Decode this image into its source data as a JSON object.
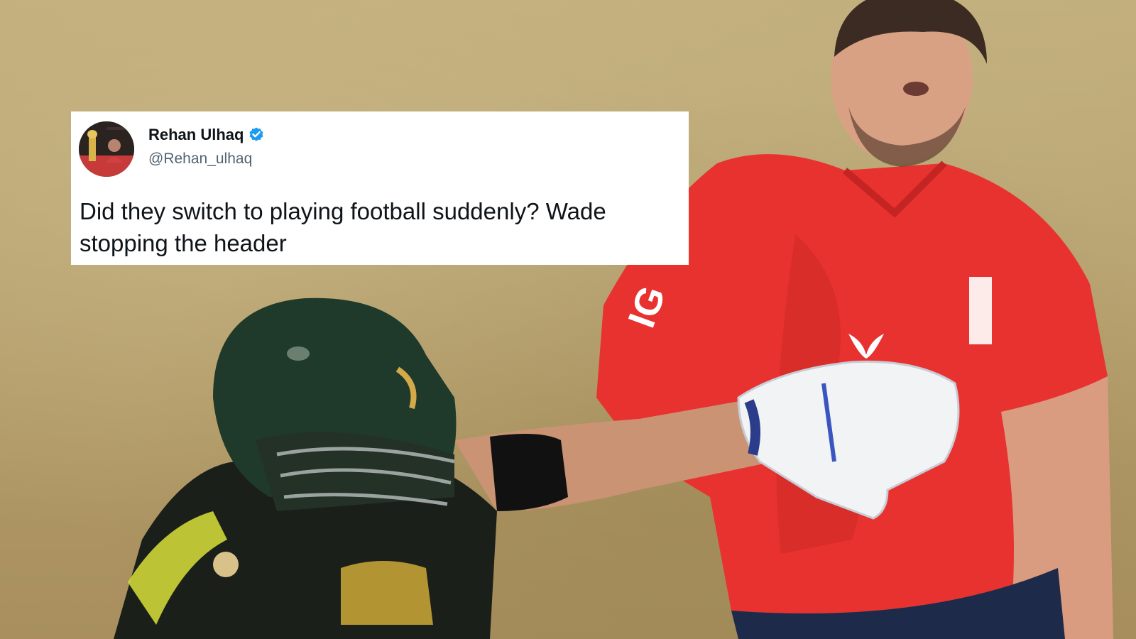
{
  "tweet": {
    "display_name": "Rehan Ulhaq",
    "handle": "@Rehan_ulhaq",
    "text": "Did they switch to playing football suddenly? Wade\nstopping the header",
    "verified": true
  },
  "icons": {
    "verified": "verified-badge-icon"
  },
  "colors": {
    "verified_blue": "#1d9bf0",
    "england_shirt": "#e8322f",
    "australia_helmet": "#1f3a2a",
    "australia_shirt_trim": "#d8e03a"
  },
  "photo": {
    "jersey_logo_text": "IG"
  }
}
